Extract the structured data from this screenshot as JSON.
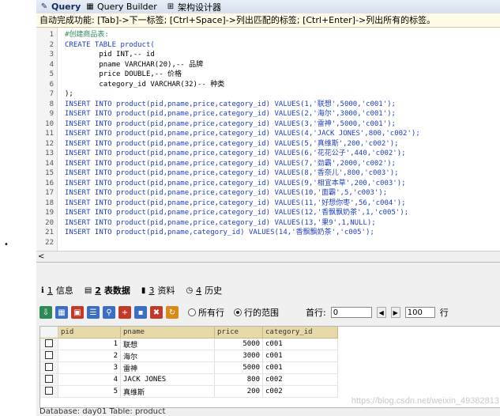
{
  "tabs": [
    {
      "label": "Query",
      "active": true
    },
    {
      "label": "Query Builder",
      "active": false
    },
    {
      "label": "架构设计器",
      "active": false
    }
  ],
  "hint": "自动完成功能: [Tab]->下一标签; [Ctrl+Space]->列出匹配的标签; [Ctrl+Enter]->列出所有的标签。",
  "editor": {
    "lines": [
      {
        "n": "1",
        "text": "#创建商品表:"
      },
      {
        "n": "2",
        "text": "CREATE TABLE product("
      },
      {
        "n": "3",
        "text": "        pid INT,-- id"
      },
      {
        "n": "4",
        "text": "        pname VARCHAR(20),-- 品牌"
      },
      {
        "n": "5",
        "text": "        price DOUBLE,-- 价格"
      },
      {
        "n": "6",
        "text": "        category_id VARCHAR(32)-- 种类"
      },
      {
        "n": "7",
        "text": ");"
      },
      {
        "n": "8",
        "text": "INSERT INTO product(pid,pname,price,category_id) VALUES(1,'联想',5000,'c001');"
      },
      {
        "n": "9",
        "text": "INSERT INTO product(pid,pname,price,category_id) VALUES(2,'海尔',3000,'c001');"
      },
      {
        "n": "10",
        "text": "INSERT INTO product(pid,pname,price,category_id) VALUES(3,'雷神',5000,'c001');"
      },
      {
        "n": "11",
        "text": "INSERT INTO product(pid,pname,price,category_id) VALUES(4,'JACK JONES',800,'c002');"
      },
      {
        "n": "12",
        "text": "INSERT INTO product(pid,pname,price,category_id) VALUES(5,'真维斯',200,'c002');"
      },
      {
        "n": "13",
        "text": "INSERT INTO product(pid,pname,price,category_id) VALUES(6,'花花公子',440,'c002');"
      },
      {
        "n": "14",
        "text": "INSERT INTO product(pid,pname,price,category_id) VALUES(7,'劲霸',2000,'c002');"
      },
      {
        "n": "15",
        "text": "INSERT INTO product(pid,pname,price,category_id) VALUES(8,'香奈儿',800,'c003');"
      },
      {
        "n": "16",
        "text": "INSERT INTO product(pid,pname,price,category_id) VALUES(9,'相宜本草',200,'c003');"
      },
      {
        "n": "17",
        "text": "INSERT INTO product(pid,pname,price,category_id) VALUES(10,'面霸',5,'c003');"
      },
      {
        "n": "18",
        "text": "INSERT INTO product(pid,pname,price,category_id) VALUES(11,'好想你枣',56,'c004');"
      },
      {
        "n": "19",
        "text": "INSERT INTO product(pid,pname,price,category_id) VALUES(12,'香飘飘奶茶',1,'c005');"
      },
      {
        "n": "20",
        "text": "INSERT INTO product(pid,pname,price,category_id) VALUES(13,'果9',1,NULL);"
      },
      {
        "n": "21",
        "text": "INSERT INTO product(pid,pname,category_id) VALUES(14,'香飘飘奶茶','c005');"
      },
      {
        "n": "22",
        "text": ""
      }
    ],
    "scroll_left_icon": "arrow-left-icon"
  },
  "pane_tabs": [
    {
      "num": "1",
      "label": "信息",
      "icon": "info-icon",
      "active": false
    },
    {
      "num": "2",
      "label": "表数据",
      "icon": "table-icon",
      "active": true
    },
    {
      "num": "3",
      "label": "资料",
      "icon": "chart-icon",
      "active": false
    },
    {
      "num": "4",
      "label": "历史",
      "icon": "history-icon",
      "active": false
    }
  ],
  "toolbar": {
    "radio_all": "所有行",
    "radio_range": "行的范围",
    "first_row_label": "首行:",
    "first_row_value": "0",
    "rows_value": "100",
    "rows_label": "行"
  },
  "grid": {
    "columns": [
      "pid",
      "pname",
      "price",
      "category_id"
    ],
    "rows": [
      [
        "1",
        "联想",
        "5000",
        "c001"
      ],
      [
        "2",
        "海尔",
        "3000",
        "c001"
      ],
      [
        "3",
        "雷神",
        "5000",
        "c001"
      ],
      [
        "4",
        "JACK JONES",
        "800",
        "c002"
      ],
      [
        "5",
        "真维斯",
        "200",
        "c002"
      ]
    ],
    "watermark": "https://blog.csdn.net/weixin_49382813"
  },
  "status": "Database: day01  Table: product"
}
